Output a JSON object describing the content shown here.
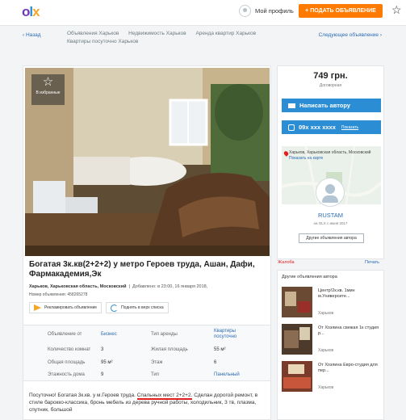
{
  "header": {
    "logo": [
      "o",
      "l",
      "x"
    ],
    "profile_label": "Мой профиль",
    "post_button": "+ ПОДАТЬ ОБЪЯВЛЕНИЕ",
    "star_icon": "star-icon"
  },
  "nav": {
    "back": "‹ Назад",
    "crumbs": [
      "Объявления Харьков",
      "Недвижимость Харьков",
      "Аренда квартир Харьков",
      "Квартиры посуточно Харьков"
    ],
    "next": "Следующее объявление ›"
  },
  "listing": {
    "fav_label": "В избранные",
    "title": "Богатая 3к.кв(2+2+2) у метро Героев труда, Ашан, Дафи, Фармакадемия,Эк",
    "location": "Харьков, Харьковская область, Московский",
    "added": "Добавлено: в 23:00, 16 января 2018,",
    "ad_number": "Номер объявления: 458265278",
    "promote": "Рекламировать объявление",
    "raise": "Поднять в верх списка",
    "props": [
      {
        "label": "Объявление от",
        "value": "Бизнес",
        "link": true
      },
      {
        "label": "Тип аренды",
        "value": "Квартиры посуточно",
        "link": true
      },
      {
        "label": "Количество комнат",
        "value": "3",
        "link": false
      },
      {
        "label": "Жилая площадь",
        "value": "55 м²",
        "link": false
      },
      {
        "label": "Общая площадь",
        "value": "95 м²",
        "link": false
      },
      {
        "label": "Этаж",
        "value": "6",
        "link": false
      },
      {
        "label": "Этажность дома",
        "value": "9",
        "link": false
      },
      {
        "label": "Тип",
        "value": "Панельный",
        "link": true
      }
    ],
    "desc_1": "Посуточно! Богатая 3к.кв. у м.Героев труда.",
    "desc_red": "Спальных мест 2+2+2.",
    "desc_2": "Сделан дорогой ремонт, в стиле барокко-классика, бронь",
    "desc_3": "мебель из дерева ручной работы, холодильник, 3 тв, плазма, спутник, большой"
  },
  "sidebar": {
    "price": "749 грн.",
    "price_note": "Договорная",
    "write_author": "Написать автору",
    "phone": "09х ххх хххх",
    "phone_show": "Показать",
    "map_address": "Харьков, Харьковская область, Московский",
    "map_show": "Показать на карте",
    "user_name": "RUSTAM",
    "user_since": "на OLX с июня 2017",
    "other_ads": "Другие объявления автора",
    "complain": "Жалоба",
    "print": "Печать"
  },
  "other": {
    "heading": "Другие объявления автора",
    "items": [
      {
        "title": "Центр!2к.кв. 1мин м.Университе...",
        "city": "Харьков"
      },
      {
        "title": "От Хозяина свежая 1к студия р...",
        "city": "Харьков"
      },
      {
        "title": "От Хозяина Евро-студия для пер...",
        "city": "Харьков"
      }
    ]
  },
  "colors": {
    "accent": "#2b8ed5",
    "brand_orange": "#ff7a00",
    "link": "#2b6bb5"
  }
}
